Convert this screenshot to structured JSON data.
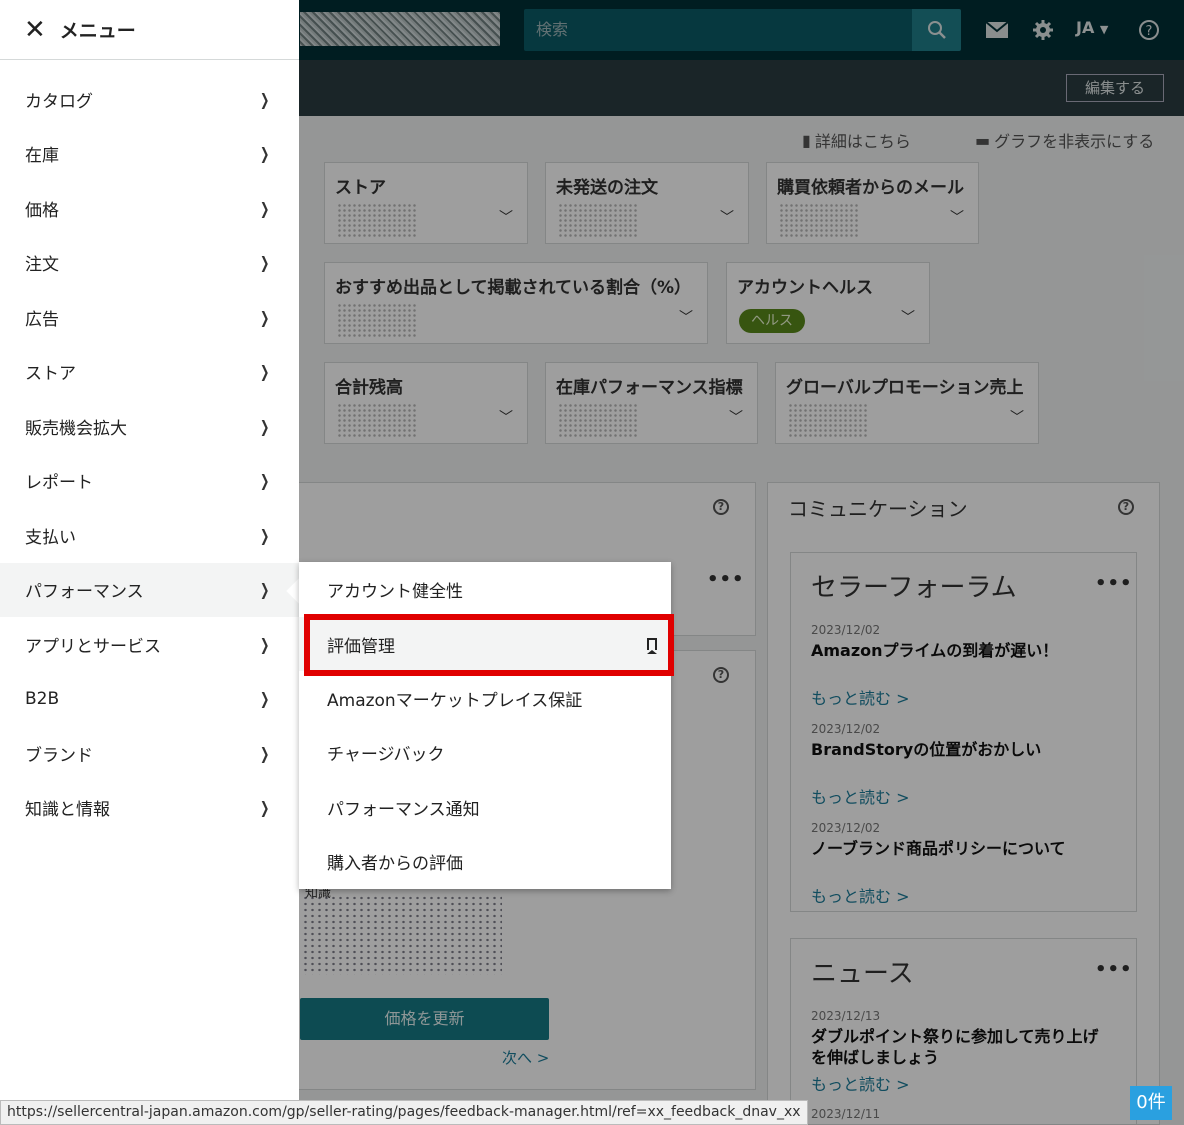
{
  "topbar": {
    "search_placeholder": "検索",
    "lang": "JA",
    "edit_label": "編集する"
  },
  "links": {
    "details": "詳細はこちら",
    "hide_graph": "グラフを非表示にする"
  },
  "cards": [
    {
      "title": "ストア"
    },
    {
      "title": "未発送の注文"
    },
    {
      "title": "購買依頼者からのメール"
    },
    {
      "title": "おすすめ出品として掲載されている割合（%）"
    },
    {
      "title": "アカウントヘルス",
      "badge": "ヘルス"
    },
    {
      "title": "合計残高"
    },
    {
      "title": "在庫パフォーマンス指標"
    },
    {
      "title": "グローバルプロモーション売上"
    }
  ],
  "communication": {
    "title": "コミュニケーション",
    "forum": {
      "title": "セラーフォーラム",
      "posts": [
        {
          "date": "2023/12/02",
          "headline": "Amazonプライムの到着が遅い！",
          "more": "もっと読む >"
        },
        {
          "date": "2023/12/02",
          "headline": "BrandStoryの位置がおかしい",
          "more": "もっと読む >"
        },
        {
          "date": "2023/12/02",
          "headline": "ノーブランド商品ポリシーについて",
          "more": "もっと読む >"
        }
      ]
    },
    "news": {
      "title": "ニュース",
      "posts": [
        {
          "date": "2023/12/13",
          "headline": "ダブルポイント祭りに参加して売り上げを伸ばしましょう",
          "more": "もっと読む >"
        },
        {
          "date": "2023/12/11"
        }
      ]
    }
  },
  "pricing": {
    "update_button": "価格を更新",
    "next_link": "次へ >",
    "fragment": "知識"
  },
  "menu": {
    "header": "メニュー",
    "items": [
      {
        "label": "カタログ"
      },
      {
        "label": "在庫"
      },
      {
        "label": "価格"
      },
      {
        "label": "注文"
      },
      {
        "label": "広告"
      },
      {
        "label": "ストア"
      },
      {
        "label": "販売機会拡大"
      },
      {
        "label": "レポート"
      },
      {
        "label": "支払い"
      },
      {
        "label": "パフォーマンス"
      },
      {
        "label": "アプリとサービス"
      },
      {
        "label": "B2B"
      },
      {
        "label": "ブランド"
      },
      {
        "label": "知識と情報"
      }
    ],
    "active_item": "パフォーマンス"
  },
  "submenu": {
    "items": [
      {
        "label": "アカウント健全性"
      },
      {
        "label": "評価管理"
      },
      {
        "label": "Amazonマーケットプレイス保証"
      },
      {
        "label": "チャージバック"
      },
      {
        "label": "パフォーマンス通知"
      },
      {
        "label": "購入者からの評価"
      }
    ],
    "highlighted_item": "評価管理"
  },
  "status_bar": {
    "url": "https://sellercentral-japan.amazon.com/gp/seller-rating/pages/feedback-manager.html/ref=xx_feedback_dnav_xx"
  },
  "badge": {
    "count": "0件"
  },
  "colors": {
    "topbar": "#002f36",
    "accent": "#157a85",
    "highlight_box": "#e00000",
    "badge": "#2aa0e0"
  }
}
